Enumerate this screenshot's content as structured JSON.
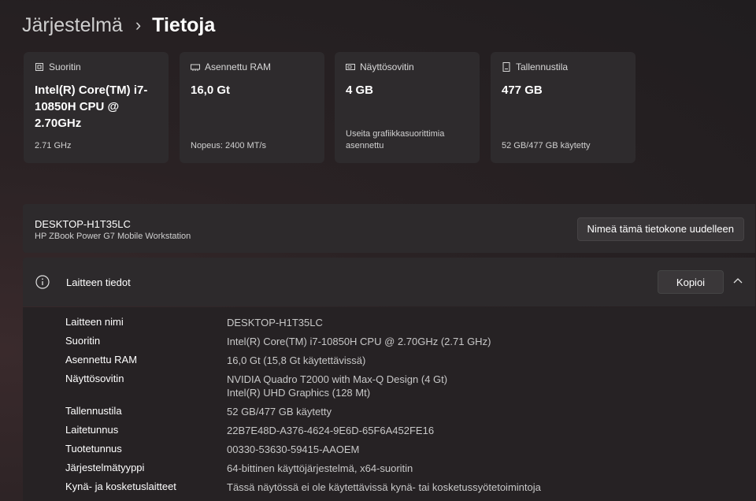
{
  "breadcrumb": {
    "parent": "Järjestelmä",
    "separator": "›",
    "current": "Tietoja"
  },
  "cards": [
    {
      "icon": "processor-icon",
      "label": "Suoritin",
      "value": "Intel(R) Core(TM) i7-10850H CPU @ 2.70GHz",
      "footer": "2.71 GHz"
    },
    {
      "icon": "ram-icon",
      "label": "Asennettu RAM",
      "value": "16,0 Gt",
      "footer": "Nopeus: 2400 MT/s"
    },
    {
      "icon": "display-adapter-icon",
      "label": "Näyttösovitin",
      "value": "4 GB",
      "footer": "Useita grafiikkasuorittimia asennettu"
    },
    {
      "icon": "storage-icon",
      "label": "Tallennustila",
      "value": "477 GB",
      "footer": "52 GB/477 GB käytetty"
    }
  ],
  "device": {
    "name": "DESKTOP-H1T35LC",
    "model": "HP ZBook Power G7 Mobile Workstation",
    "rename_label": "Nimeä tämä tietokone uudelleen"
  },
  "specs": {
    "title": "Laitteen tiedot",
    "copy_label": "Kopioi",
    "rows": [
      {
        "key": "Laitteen nimi",
        "value": "DESKTOP-H1T35LC"
      },
      {
        "key": "Suoritin",
        "value": "Intel(R) Core(TM) i7-10850H CPU @ 2.70GHz (2.71 GHz)"
      },
      {
        "key": "Asennettu RAM",
        "value": "16,0 Gt (15,8 Gt käytettävissä)"
      },
      {
        "key": "Näyttösovitin",
        "value": "NVIDIA Quadro T2000 with Max-Q Design (4 Gt)",
        "value2": "Intel(R) UHD Graphics (128 Mt)"
      },
      {
        "key": "Tallennustila",
        "value": "52 GB/477 GB käytetty"
      },
      {
        "key": "Laitetunnus",
        "value": "22B7E48D-A376-4624-9E6D-65F6A452FE16"
      },
      {
        "key": "Tuotetunnus",
        "value": "00330-53630-59415-AAOEM"
      },
      {
        "key": "Järjestelmätyyppi",
        "value": "64-bittinen käyttöjärjestelmä, x64-suoritin"
      },
      {
        "key": "Kynä- ja kosketuslaitteet",
        "value": "Tässä näytössä ei ole käytettävissä kynä- tai kosketussyötetoimintoja"
      }
    ]
  }
}
